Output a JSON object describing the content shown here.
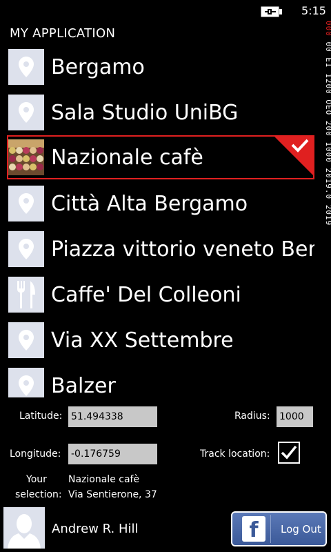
{
  "status": {
    "time": "5:15",
    "battery_icon": "battery-charging-icon"
  },
  "app": {
    "title": "MY APPLICATION"
  },
  "side_ticker": {
    "prefix": "000",
    "text": "00 EI 1200 OEO 200 1000 2019.0 2019"
  },
  "places": [
    {
      "name": "Bergamo",
      "icon": "map-pin-icon"
    },
    {
      "name": "Sala Studio UniBG",
      "icon": "map-pin-icon"
    },
    {
      "name": "Nazionale cafè",
      "icon": "photo-thumbnail",
      "selected": true
    },
    {
      "name": "Città Alta Bergamo",
      "icon": "map-pin-icon"
    },
    {
      "name": "Piazza vittorio veneto Bergamo",
      "icon": "map-pin-icon"
    },
    {
      "name": "Caffe' Del Colleoni",
      "icon": "restaurant-icon"
    },
    {
      "name": "Via XX Settembre",
      "icon": "map-pin-icon"
    },
    {
      "name": "Balzer",
      "icon": "map-pin-icon"
    }
  ],
  "form": {
    "latitude_label": "Latitude:",
    "latitude_value": "51.494338",
    "radius_label": "Radius:",
    "radius_value": "1000",
    "longitude_label": "Longitude:",
    "longitude_value": "-0.176759",
    "track_label": "Track location:",
    "track_checked": true,
    "selection_label_1": "Your",
    "selection_label_2": "selection:",
    "selection_name": "Nazionale cafè",
    "selection_address": "Via Sentierone, 37"
  },
  "user": {
    "name": "Andrew R. Hill",
    "avatar": "avatar-placeholder"
  },
  "logout": {
    "label": "Log Out",
    "logo": "f"
  },
  "colors": {
    "accent": "#e02020",
    "tile": "#dde1ec",
    "facebook": "#3b5998",
    "field": "#c8c8c8"
  }
}
